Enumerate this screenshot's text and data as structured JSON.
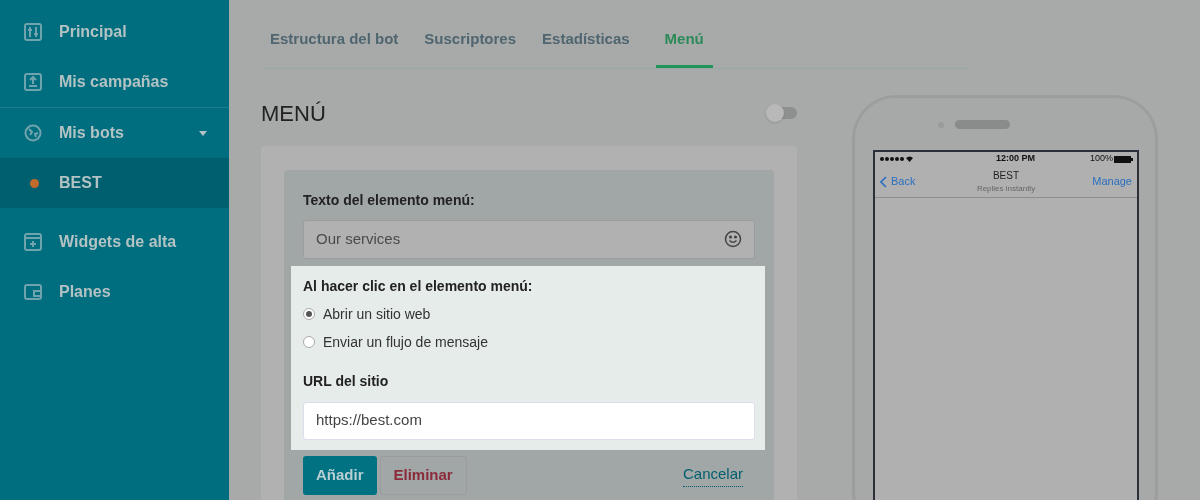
{
  "sidebar": {
    "items": [
      {
        "label": "Principal",
        "kind": "sliders",
        "selected": false
      },
      {
        "label": "Mis campañas",
        "kind": "upload",
        "selected": false
      },
      {
        "label": "Mis bots",
        "kind": "globe",
        "selected": false,
        "expanded": true,
        "children": [
          {
            "label": "BEST",
            "color": "#c26a2a",
            "selected": true
          }
        ]
      },
      {
        "label": "Widgets de alta",
        "kind": "widget",
        "selected": false
      },
      {
        "label": "Planes",
        "kind": "wallet",
        "selected": false
      }
    ]
  },
  "tabs": [
    {
      "label": "Estructura del bot",
      "selected": false
    },
    {
      "label": "Suscriptores",
      "selected": false
    },
    {
      "label": "Estadísticas",
      "selected": false
    },
    {
      "label": "Menú",
      "selected": true
    }
  ],
  "page_title": "MENÚ",
  "menu_toggle": {
    "on": false
  },
  "form": {
    "text_label": "Texto del elemento menú:",
    "text_value": "Our services",
    "click_label": "Al hacer clic en el elemento menú:",
    "options": [
      {
        "label": "Abrir un sitio web",
        "selected": true
      },
      {
        "label": "Enviar un flujo de mensaje",
        "selected": false
      }
    ],
    "url_label": "URL del sitio",
    "url_value": "https://best.com",
    "add": "Añadir",
    "delete": "Eliminar",
    "cancel": "Cancelar"
  },
  "phone": {
    "time": "12:00 PM",
    "battery": "100%",
    "back": "Back",
    "title": "BEST",
    "subtitle": "Replies instantly",
    "manage": "Manage"
  }
}
